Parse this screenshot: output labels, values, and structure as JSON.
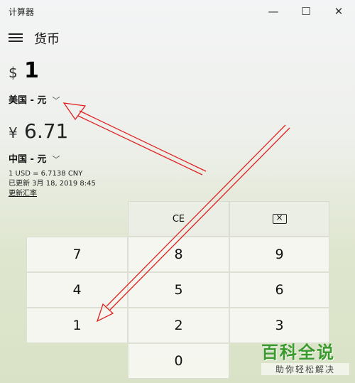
{
  "window": {
    "title": "计算器",
    "minimize": "—",
    "maximize": "☐",
    "close": "✕"
  },
  "header": {
    "menu_icon": "hamburger-icon",
    "mode": "货币"
  },
  "from": {
    "symbol": "$",
    "value": "1",
    "currency": "美国 - 元"
  },
  "to": {
    "symbol": "¥",
    "value": "6.71",
    "currency": "中国 - 元"
  },
  "rate": {
    "line": "1 USD = 6.7138 CNY",
    "updated": "已更新 3月 18, 2019 8:45",
    "refresh": "更新汇率"
  },
  "keys": {
    "ce": "CE",
    "backspace_icon": "backspace-icon",
    "k7": "7",
    "k8": "8",
    "k9": "9",
    "k4": "4",
    "k5": "5",
    "k6": "6",
    "k1": "1",
    "k2": "2",
    "k3": "3",
    "k0": "0"
  },
  "colors": {
    "annotation_arrow": "#e02020",
    "watermark_green": "#3a9a2e"
  },
  "watermark": {
    "title": "百科全说",
    "subtitle": "助你轻松解决"
  }
}
